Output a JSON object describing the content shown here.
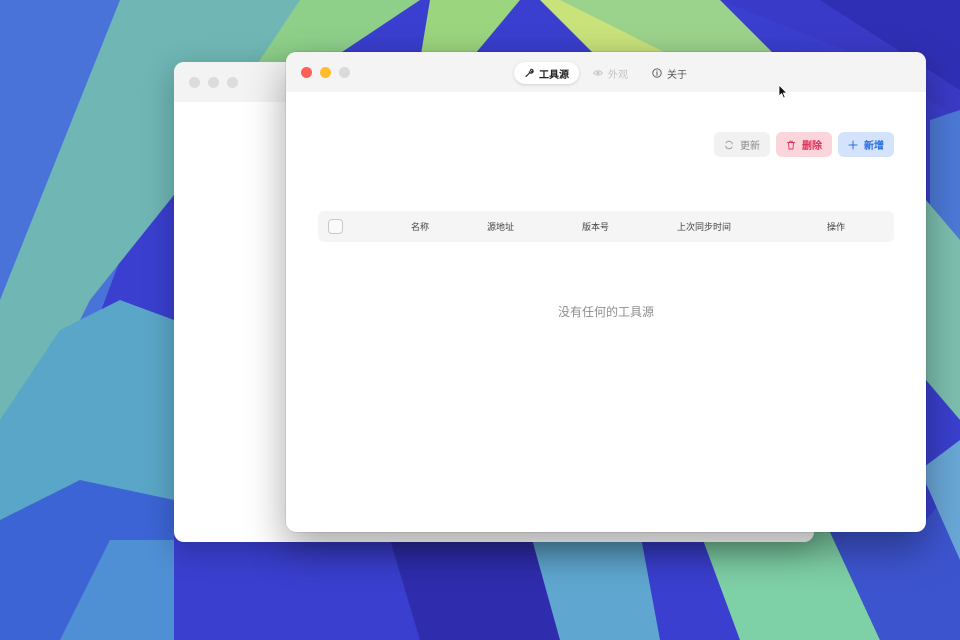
{
  "wallpaper": {
    "base_color": "#3b3fd0"
  },
  "window_front": {
    "tabs": [
      {
        "label": "工具源",
        "icon": "wrench-icon",
        "state": "active"
      },
      {
        "label": "外观",
        "icon": "eye-icon",
        "state": "disabled"
      },
      {
        "label": "关于",
        "icon": "info-icon",
        "state": "normal"
      }
    ],
    "toolbar": {
      "refresh_label": "更新",
      "delete_label": "删除",
      "add_label": "新增"
    },
    "table": {
      "columns": [
        "名称",
        "源地址",
        "版本号",
        "上次同步时间",
        "操作"
      ],
      "rows": [],
      "empty_message": "没有任何的工具源"
    },
    "colors": {
      "delete_bg": "#fbd5dc",
      "delete_text": "#e0325a",
      "add_bg": "#d3e3fb",
      "add_text": "#2c6fe0",
      "close": "#fe5f57",
      "minimize": "#febc2e"
    }
  }
}
